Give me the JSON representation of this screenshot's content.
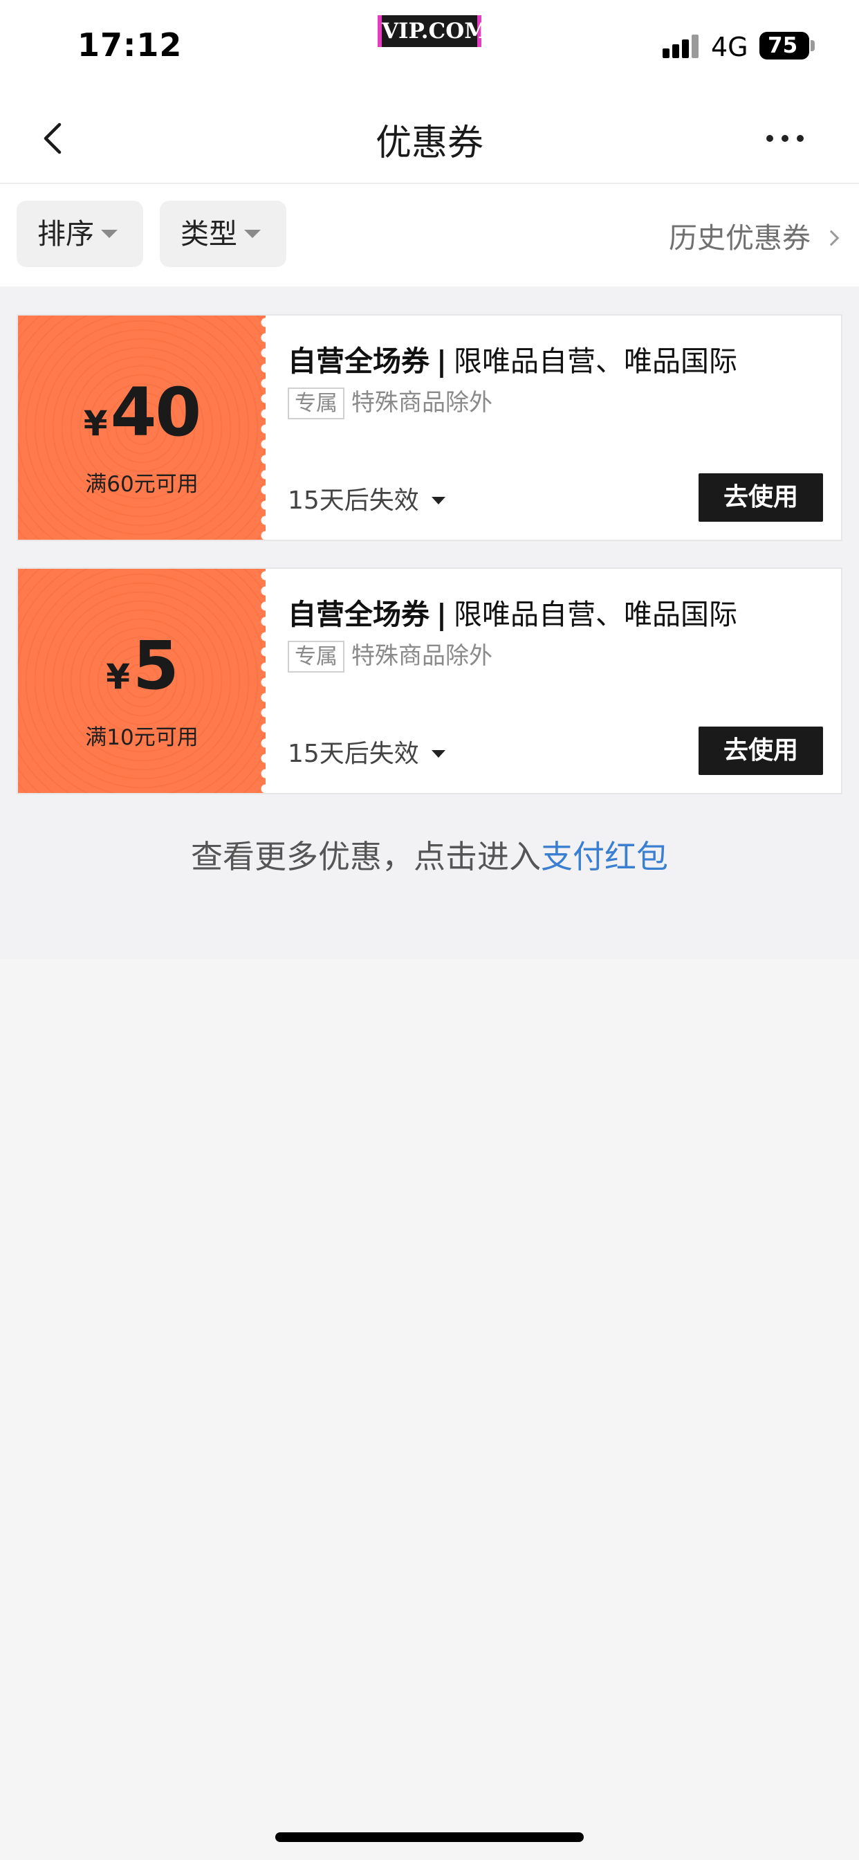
{
  "status_bar": {
    "time": "17:12",
    "logo": "VIP.COM",
    "network": "4G",
    "battery": "75"
  },
  "nav": {
    "title": "优惠券",
    "back_icon": "chevron-left-icon",
    "more_icon": "more-dots-icon"
  },
  "filters": {
    "sort_label": "排序",
    "type_label": "类型",
    "history_label": "历史优惠券"
  },
  "coupons": [
    {
      "currency": "¥",
      "amount": "40",
      "threshold": "满60元可用",
      "title_bold": "自营全场券",
      "title_sep": "|",
      "title_rest": "限唯品自营、唯品国际",
      "tag": "专属",
      "note": "特殊商品除外",
      "expire": "15天后失效",
      "action": "去使用"
    },
    {
      "currency": "¥",
      "amount": "5",
      "threshold": "满10元可用",
      "title_bold": "自营全场券",
      "title_sep": "|",
      "title_rest": "限唯品自营、唯品国际",
      "tag": "专属",
      "note": "特殊商品除外",
      "expire": "15天后失效",
      "action": "去使用"
    }
  ],
  "footer": {
    "text": "查看更多优惠，点击进入",
    "link": "支付红包"
  },
  "colors": {
    "coupon_accent": "#ff7a4c",
    "button_bg": "#1a1a1a",
    "link": "#3a7fd0"
  }
}
